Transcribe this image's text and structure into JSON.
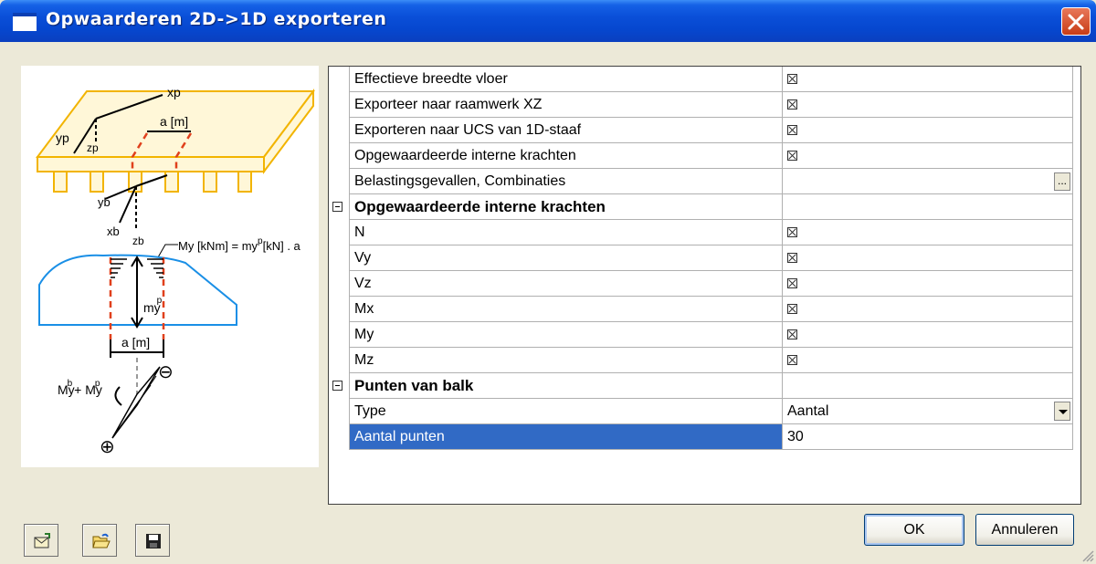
{
  "window": {
    "title": "Opwaarderen 2D->1D exporteren"
  },
  "diagram": {
    "labels": {
      "xp": "xp",
      "yp": "yp",
      "zp": "zp",
      "a_top": "a [m]",
      "yb": "yb",
      "xb": "xb",
      "zb": "zb",
      "formula": "My [kNm] = my",
      "formula_p": "p",
      "formula_end": "[kN] . a",
      "my": "my",
      "my_p": "p",
      "a_bottom": "a [m]",
      "sum_a": "My",
      "sum_a_sup": "b",
      "sum_plus": " + My",
      "sum_b_sup": "p",
      "minus": "⊖",
      "plus": "⊕"
    }
  },
  "grid": {
    "rows": [
      {
        "kind": "prop",
        "name": "Effectieve breedte vloer",
        "value": "checked"
      },
      {
        "kind": "prop",
        "name": "Exporteer naar raamwerk XZ",
        "value": "checked"
      },
      {
        "kind": "prop",
        "name": "Exporteren naar UCS van 1D-staaf",
        "value": "checked"
      },
      {
        "kind": "prop",
        "name": "Opgewaardeerde interne krachten",
        "value": "checked"
      },
      {
        "kind": "button",
        "name": "Belastingsgevallen, Combinaties",
        "button_label": "..."
      },
      {
        "kind": "category",
        "name": "Opgewaardeerde interne krachten"
      },
      {
        "kind": "prop",
        "name": "N",
        "value": "checked"
      },
      {
        "kind": "prop",
        "name": "Vy",
        "value": "checked"
      },
      {
        "kind": "prop",
        "name": "Vz",
        "value": "checked"
      },
      {
        "kind": "prop",
        "name": "Mx",
        "value": "checked"
      },
      {
        "kind": "prop",
        "name": "My",
        "value": "checked"
      },
      {
        "kind": "prop",
        "name": "Mz",
        "value": "checked"
      },
      {
        "kind": "category",
        "name": "Punten van balk"
      },
      {
        "kind": "select",
        "name": "Type",
        "value": "Aantal"
      },
      {
        "kind": "text",
        "name": "Aantal punten",
        "value": "30",
        "selected": true
      }
    ]
  },
  "toolbar": {
    "icons": [
      "export-icon",
      "open-folder-icon",
      "save-icon"
    ]
  },
  "buttons": {
    "ok": "OK",
    "cancel": "Annuleren"
  }
}
